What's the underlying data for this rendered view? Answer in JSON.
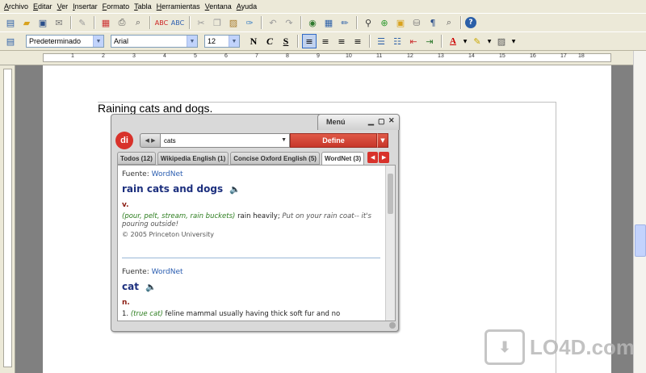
{
  "menubar": {
    "items": [
      "Archivo",
      "Editar",
      "Ver",
      "Insertar",
      "Formato",
      "Tabla",
      "Herramientas",
      "Ventana",
      "Ayuda"
    ]
  },
  "formatting": {
    "style": "Predeterminado",
    "font": "Arial",
    "size": "12",
    "bold_label": "N",
    "italic_label": "C",
    "underline_label": "S"
  },
  "ruler": {
    "labels": [
      "1",
      "2",
      "3",
      "4",
      "5",
      "6",
      "7",
      "8",
      "9",
      "10",
      "11",
      "12",
      "13",
      "14",
      "15",
      "16",
      "17",
      "18"
    ]
  },
  "document": {
    "text": "Raining cats and dogs."
  },
  "popup": {
    "title": "Menú",
    "logo": "di",
    "search_value": "cats",
    "define_label": "Define",
    "tabs": [
      {
        "label": "Todos (12)",
        "active": false
      },
      {
        "label": "Wikipedia English (1)",
        "active": false
      },
      {
        "label": "Concise Oxford English (5)",
        "active": false
      },
      {
        "label": "WordNet (3)",
        "active": true
      }
    ],
    "entries": [
      {
        "source_label": "Fuente:",
        "source": "WordNet",
        "headword": "rain cats and dogs",
        "pos": "v.",
        "synonyms": "(pour, pelt, stream, rain buckets)",
        "definition": "rain heavily;",
        "example": "Put on your rain coat-- it's pouring outside!",
        "copyright": "© 2005 Princeton University"
      },
      {
        "source_label": "Fuente:",
        "source": "WordNet",
        "headword": "cat",
        "pos": "n.",
        "number": "1.",
        "synonyms": "(true cat)",
        "definition": "feline mammal usually having thick soft fur and no"
      }
    ]
  },
  "watermark": {
    "text": "LO4D.com"
  }
}
